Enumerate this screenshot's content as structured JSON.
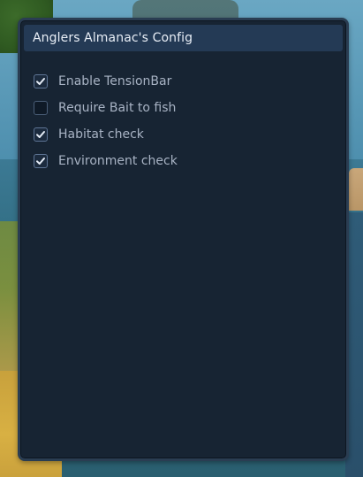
{
  "config": {
    "title": "Anglers Almanac's Config",
    "options": [
      {
        "label": "Enable TensionBar",
        "checked": true
      },
      {
        "label": "Require Bait to fish",
        "checked": false
      },
      {
        "label": "Habitat check",
        "checked": true
      },
      {
        "label": "Environment check",
        "checked": true
      }
    ]
  },
  "colors": {
    "panel_bg": "#172433",
    "header_bg": "#243a55",
    "label_text": "#a8b3c4",
    "title_text": "#e8eef6",
    "check_mark": "#e6edf7"
  },
  "icons": {
    "check": "check-icon"
  }
}
